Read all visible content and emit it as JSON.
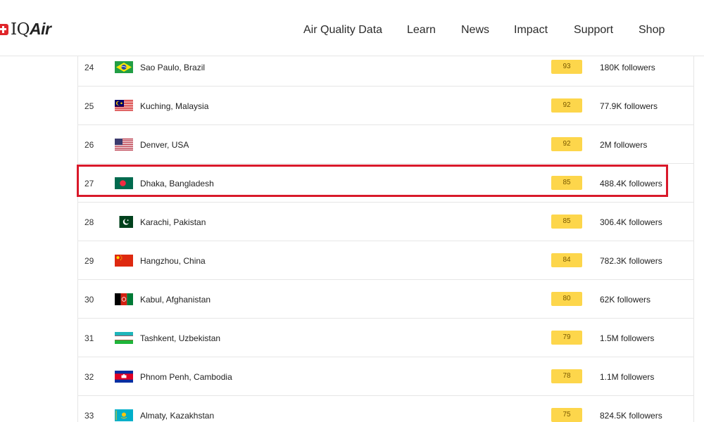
{
  "header": {
    "logo_text_plain": "IQ",
    "logo_text_em": "Air",
    "nav": [
      {
        "label": "Air Quality Data"
      },
      {
        "label": "Learn"
      },
      {
        "label": "News"
      },
      {
        "label": "Impact"
      },
      {
        "label": "Support"
      },
      {
        "label": "Shop"
      }
    ]
  },
  "ranking": [
    {
      "rank": "24",
      "city": "Sao Paulo, Brazil",
      "aqi": "93",
      "followers": "180K followers",
      "flag": "brazil"
    },
    {
      "rank": "25",
      "city": "Kuching, Malaysia",
      "aqi": "92",
      "followers": "77.9K followers",
      "flag": "malaysia"
    },
    {
      "rank": "26",
      "city": "Denver, USA",
      "aqi": "92",
      "followers": "2M followers",
      "flag": "usa"
    },
    {
      "rank": "27",
      "city": "Dhaka, Bangladesh",
      "aqi": "85",
      "followers": "488.4K followers",
      "flag": "bangladesh"
    },
    {
      "rank": "28",
      "city": "Karachi, Pakistan",
      "aqi": "85",
      "followers": "306.4K followers",
      "flag": "pakistan"
    },
    {
      "rank": "29",
      "city": "Hangzhou, China",
      "aqi": "84",
      "followers": "782.3K followers",
      "flag": "china"
    },
    {
      "rank": "30",
      "city": "Kabul, Afghanistan",
      "aqi": "80",
      "followers": "62K followers",
      "flag": "afghanistan"
    },
    {
      "rank": "31",
      "city": "Tashkent, Uzbekistan",
      "aqi": "79",
      "followers": "1.5M followers",
      "flag": "uzbekistan"
    },
    {
      "rank": "32",
      "city": "Phnom Penh, Cambodia",
      "aqi": "78",
      "followers": "1.1M followers",
      "flag": "cambodia"
    },
    {
      "rank": "33",
      "city": "Almaty, Kazakhstan",
      "aqi": "75",
      "followers": "824.5K followers",
      "flag": "kazakhstan"
    }
  ],
  "colors": {
    "aqi_badge": "#fdd64b",
    "highlight": "#d9192a",
    "logo_red": "#e0262b"
  }
}
